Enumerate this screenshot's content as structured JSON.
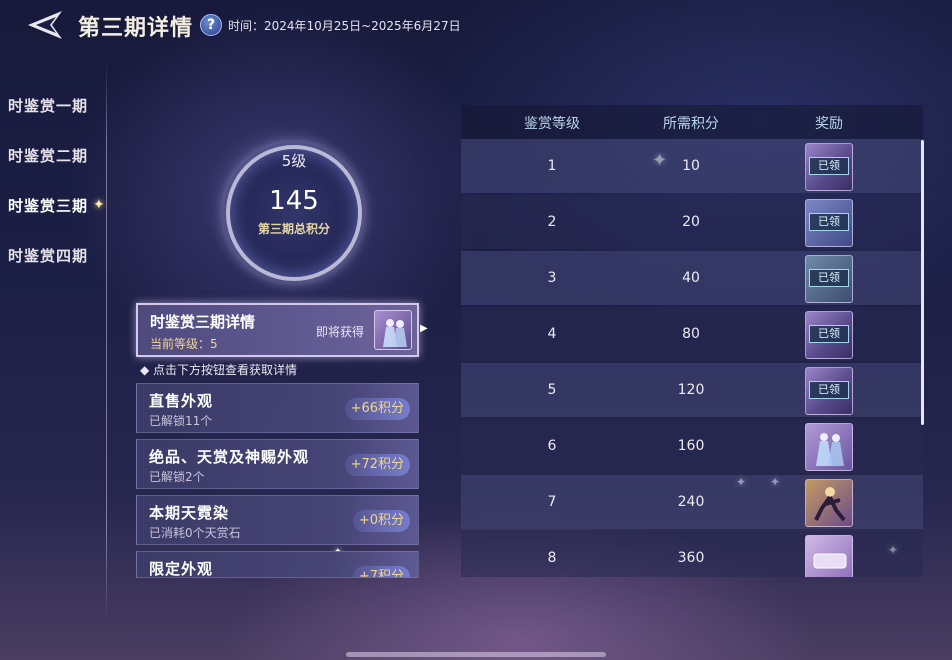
{
  "header": {
    "title": "第三期详情",
    "help_label": "?",
    "time_label": "时间：2024年10月25日~2025年6月27日"
  },
  "nav": {
    "items": [
      {
        "label": "时鉴赏一期"
      },
      {
        "label": "时鉴赏二期"
      },
      {
        "label": "时鉴赏三期"
      },
      {
        "label": "时鉴赏四期"
      }
    ],
    "active_index": 2
  },
  "score_ring": {
    "level": "5级",
    "score": "145",
    "label": "第三期总积分"
  },
  "detail_card": {
    "title": "时鉴赏三期详情",
    "current_level": "当前等级：5",
    "upcoming_label": "即将获得"
  },
  "hint": "◆ 点击下方按钮查看获取详情",
  "categories": [
    {
      "title": "直售外观",
      "sub": "已解锁11个",
      "points": "+66积分"
    },
    {
      "title": "绝品、天赏及神赐外观",
      "sub": "已解锁2个",
      "points": "+72积分"
    },
    {
      "title": "本期天霓染",
      "sub": "已消耗0个天赏石",
      "points": "+0积分"
    },
    {
      "title": "限定外观",
      "sub": "",
      "points": "+7积分"
    }
  ],
  "table": {
    "headers": [
      "鉴赏等级",
      "所需积分",
      "奖励"
    ],
    "claimed_label": "已领",
    "rows": [
      {
        "level": "1",
        "points": "10",
        "claimed": true
      },
      {
        "level": "2",
        "points": "20",
        "claimed": true
      },
      {
        "level": "3",
        "points": "40",
        "claimed": true
      },
      {
        "level": "4",
        "points": "80",
        "claimed": true
      },
      {
        "level": "5",
        "points": "120",
        "claimed": true
      },
      {
        "level": "6",
        "points": "160",
        "claimed": false
      },
      {
        "level": "7",
        "points": "240",
        "claimed": false
      },
      {
        "level": "8",
        "points": "360",
        "claimed": false
      }
    ]
  },
  "colors": {
    "accent_gold": "#f3d786",
    "claimed_border": "#9fd6e8",
    "header_text": "#b8d4ea"
  }
}
